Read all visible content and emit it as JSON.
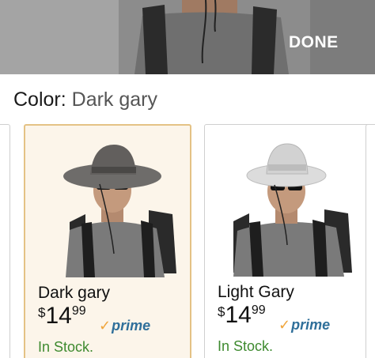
{
  "header": {
    "done_label": "DONE"
  },
  "color_selector": {
    "label": "Color:",
    "selected_value": "Dark gary"
  },
  "swatches": [
    {
      "name": "Dark gary",
      "price_symbol": "$",
      "price_dollars": "14",
      "price_cents": "99",
      "prime_label": "prime",
      "availability": "In Stock.",
      "selected": true,
      "hat_color": "#6e6c6a"
    },
    {
      "name": "Light Gary",
      "price_symbol": "$",
      "price_dollars": "14",
      "price_cents": "99",
      "prime_label": "prime",
      "availability": "In Stock.",
      "selected": false,
      "hat_color": "#d9d9d9"
    }
  ],
  "colors": {
    "selected_border": "#e4c285",
    "selected_bg": "#fcf5ea",
    "prime_blue": "#2f6f9a",
    "prime_check": "#f0a53b",
    "in_stock_green": "#3e8a2f"
  }
}
